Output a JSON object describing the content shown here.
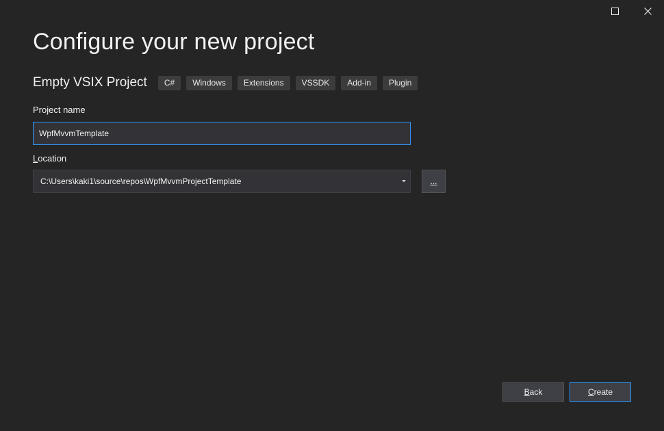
{
  "window": {
    "maximize_icon": "maximize-icon",
    "close_icon": "close-icon"
  },
  "header": {
    "title": "Configure your new project"
  },
  "template": {
    "name": "Empty VSIX Project",
    "tags": [
      "C#",
      "Windows",
      "Extensions",
      "VSSDK",
      "Add-in",
      "Plugin"
    ]
  },
  "project_name": {
    "label": "Project name",
    "value": "WpfMvvmTemplate"
  },
  "location": {
    "label_first": "L",
    "label_rest": "ocation",
    "value": "C:\\Users\\kaki1\\source\\repos\\WpfMvvmProjectTemplate",
    "browse_label": "..."
  },
  "footer": {
    "back_first": "B",
    "back_rest": "ack",
    "create_first": "C",
    "create_rest": "reate"
  },
  "colors": {
    "background": "#252526",
    "accent": "#3399ff",
    "control": "#3f3f46",
    "tag": "#3c3c3c"
  }
}
